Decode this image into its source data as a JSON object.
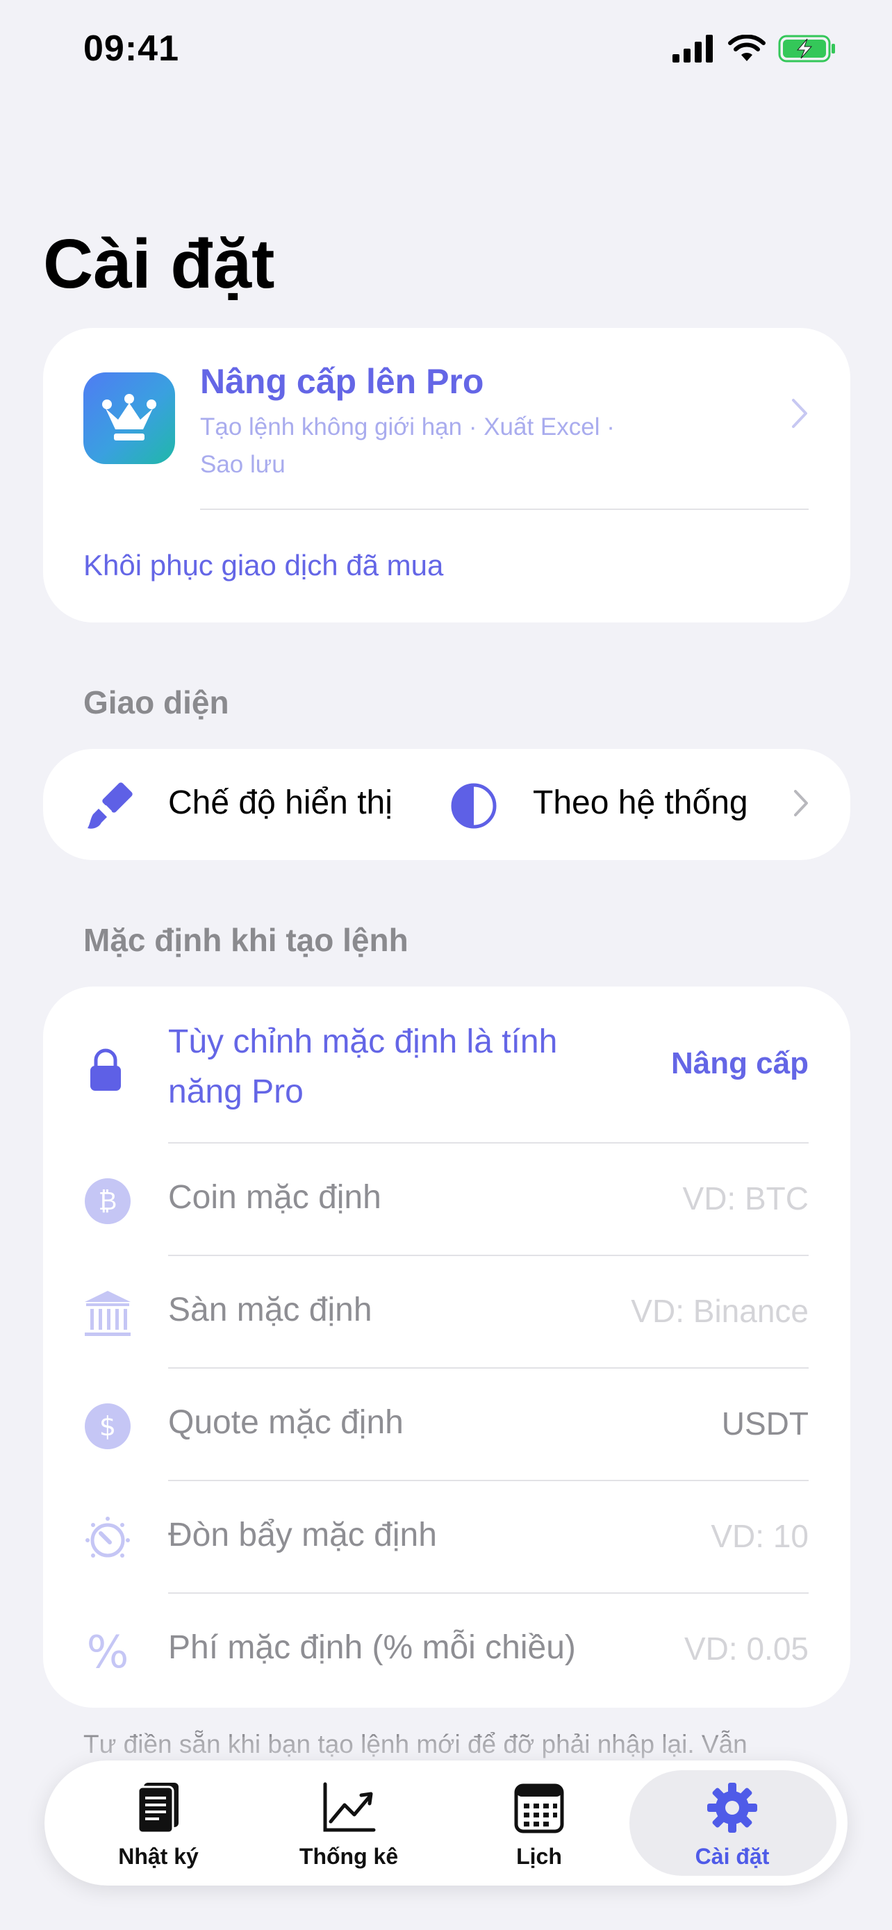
{
  "status_bar": {
    "time": "09:41"
  },
  "page_title": "Cài đặt",
  "pro_card": {
    "title": "Nâng cấp lên Pro",
    "subtitle": "Tạo lệnh không giới hạn · Xuất Excel · Sao lưu",
    "restore_label": "Khôi phục giao dịch đã mua"
  },
  "appearance": {
    "header": "Giao diện",
    "label": "Chế độ hiển thị",
    "value": "Theo hệ thống"
  },
  "defaults": {
    "header": "Mặc định khi tạo lệnh",
    "pro_notice": "Tùy chỉnh mặc định là tính năng Pro",
    "upgrade_label": "Nâng cấp",
    "rows": [
      {
        "icon": "bitcoin-icon",
        "label": "Coin mặc định",
        "value": "VD: BTC"
      },
      {
        "icon": "bank-icon",
        "label": "Sàn mặc định",
        "value": "VD: Binance"
      },
      {
        "icon": "dollar-icon",
        "label": "Quote mặc định",
        "value": "USDT"
      },
      {
        "icon": "gauge-icon",
        "label": "Đòn bẩy mặc định",
        "value": "VD: 10"
      },
      {
        "icon": "percent-icon",
        "label": "Phí mặc định (% mỗi chiều)",
        "value": "VD: 0.05"
      }
    ],
    "footnote": "Tư điền sẵn khi bạn tạo lệnh mới để đỡ phải nhập lại. Vẫn"
  },
  "tabs": [
    {
      "label": "Nhật ký",
      "icon": "journal-icon"
    },
    {
      "label": "Thống kê",
      "icon": "chart-icon"
    },
    {
      "label": "Lịch",
      "icon": "calendar-icon"
    },
    {
      "label": "Cài đặt",
      "icon": "gear-icon",
      "active": true
    }
  ],
  "colors": {
    "accent": "#6466E6",
    "accent_light": "#A9ACEE",
    "background": "#F2F2F7"
  }
}
